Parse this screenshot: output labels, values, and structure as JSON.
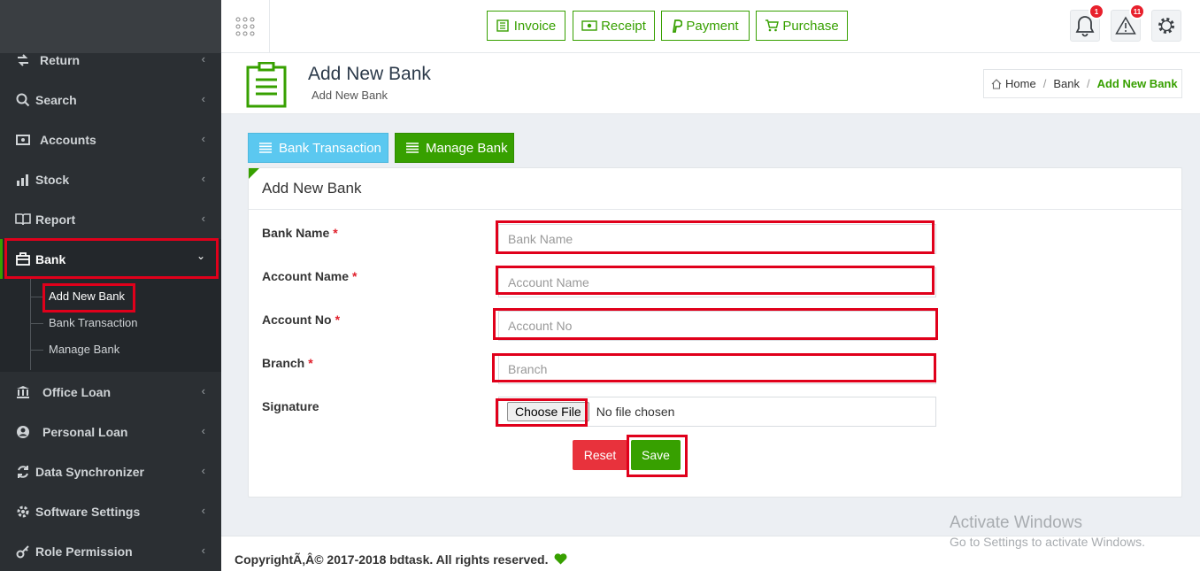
{
  "sidebar": {
    "items": [
      {
        "label": "Return",
        "icon": "return-icon"
      },
      {
        "label": "Search",
        "icon": "search-icon"
      },
      {
        "label": "Accounts",
        "icon": "money-icon"
      },
      {
        "label": "Stock",
        "icon": "bar-chart-icon"
      },
      {
        "label": "Report",
        "icon": "book-icon"
      },
      {
        "label": "Bank",
        "icon": "bank-icon"
      },
      {
        "label": "Office Loan",
        "icon": "institution-icon"
      },
      {
        "label": "Personal Loan",
        "icon": "user-circle-icon"
      },
      {
        "label": "Data Synchronizer",
        "icon": "sync-icon"
      },
      {
        "label": "Software Settings",
        "icon": "gear-icon"
      },
      {
        "label": "Role Permission",
        "icon": "key-icon"
      }
    ],
    "bank_submenu": [
      "Add New Bank",
      "Bank Transaction",
      "Manage Bank"
    ]
  },
  "topbar": {
    "quick_buttons": [
      "Invoice",
      "Receipt",
      "Payment",
      "Purchase"
    ],
    "notifications_count": "1",
    "alerts_count": "11"
  },
  "page_header": {
    "title": "Add New Bank",
    "subtitle": "Add New Bank",
    "breadcrumb": [
      "Home",
      "Bank",
      "Add New Bank"
    ]
  },
  "tabs": {
    "bank_transaction": "Bank Transaction",
    "manage_bank": "Manage Bank"
  },
  "form": {
    "title": "Add New Bank",
    "required_mark": "*",
    "fields": [
      {
        "label": "Bank Name",
        "placeholder": "Bank Name"
      },
      {
        "label": "Account Name",
        "placeholder": "Account Name"
      },
      {
        "label": "Account No",
        "placeholder": "Account No"
      },
      {
        "label": "Branch",
        "placeholder": "Branch"
      }
    ],
    "signature_label": "Signature",
    "file_button": "Choose File",
    "file_status": "No file chosen",
    "reset_label": "Reset",
    "save_label": "Save"
  },
  "footer": {
    "text": "CopyrightÃ‚Â© 2017-2018 bdtask. All rights reserved."
  },
  "watermark": {
    "line1": "Activate Windows",
    "line2": "Go to Settings to activate Windows."
  },
  "colors": {
    "accent_green": "#37a000",
    "info_blue": "#5bc0de",
    "danger_red": "#e8323c",
    "annotation_red": "#e0001b",
    "sidebar_bg": "#2b2f33"
  }
}
